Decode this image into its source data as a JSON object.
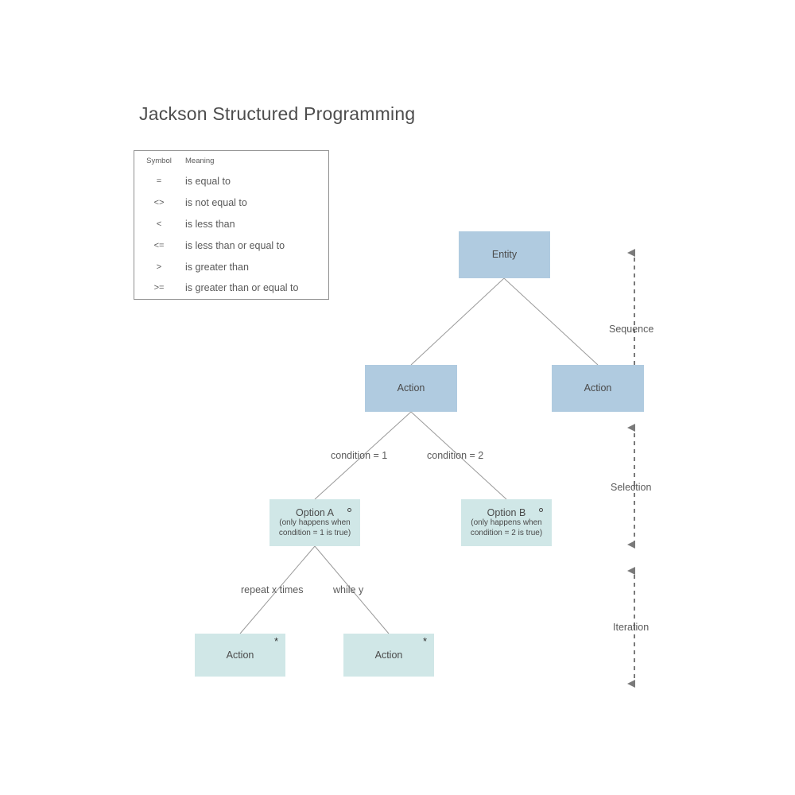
{
  "page": {
    "title": "Jackson Structured Programming",
    "background": "#ffffff"
  },
  "legend": {
    "headers": {
      "symbol": "Symbol",
      "meaning": "Meaning"
    },
    "rows": [
      {
        "symbol": "=",
        "meaning": "is equal to"
      },
      {
        "symbol": "<>",
        "meaning": "is not equal to"
      },
      {
        "symbol": "<",
        "meaning": "is less than"
      },
      {
        "symbol": "<=",
        "meaning": "is less than or equal to"
      },
      {
        "symbol": ">",
        "meaning": "is greater than"
      },
      {
        "symbol": ">=",
        "meaning": "is greater than or equal to"
      }
    ]
  },
  "colors": {
    "node_blue": "#b0cbe0",
    "node_teal": "#d0e7e7",
    "line": "#9a9a9a",
    "arrow": "#7a7a7a",
    "text": "#5a5a5a",
    "legend_border": "#8f8f8f"
  },
  "diagram": {
    "nodes": [
      {
        "id": "entity",
        "label": "Entity",
        "sub": "",
        "marker": "",
        "style": "blue"
      },
      {
        "id": "action1",
        "label": "Action",
        "sub": "",
        "marker": "",
        "style": "blue"
      },
      {
        "id": "action2",
        "label": "Action",
        "sub": "",
        "marker": "",
        "style": "blue"
      },
      {
        "id": "optionA",
        "label": "Option A",
        "sub": "(only happens when condition = 1 is true)",
        "marker": "o",
        "style": "teal"
      },
      {
        "id": "optionB",
        "label": "Option B",
        "sub": "(only happens when condition = 2 is true)",
        "marker": "o",
        "style": "teal"
      },
      {
        "id": "action3",
        "label": "Action",
        "sub": "",
        "marker": "*",
        "style": "teal"
      },
      {
        "id": "action4",
        "label": "Action",
        "sub": "",
        "marker": "*",
        "style": "teal"
      }
    ],
    "edge_labels": [
      {
        "id": "cond1",
        "text": "condition = 1"
      },
      {
        "id": "cond2",
        "text": "condition = 2"
      },
      {
        "id": "repeat",
        "text": "repeat x times"
      },
      {
        "id": "while",
        "text": "while y"
      }
    ]
  },
  "brackets": [
    {
      "id": "sequence",
      "label": "Sequence"
    },
    {
      "id": "selection",
      "label": "Selection"
    },
    {
      "id": "iteration",
      "label": "Iteration"
    }
  ]
}
